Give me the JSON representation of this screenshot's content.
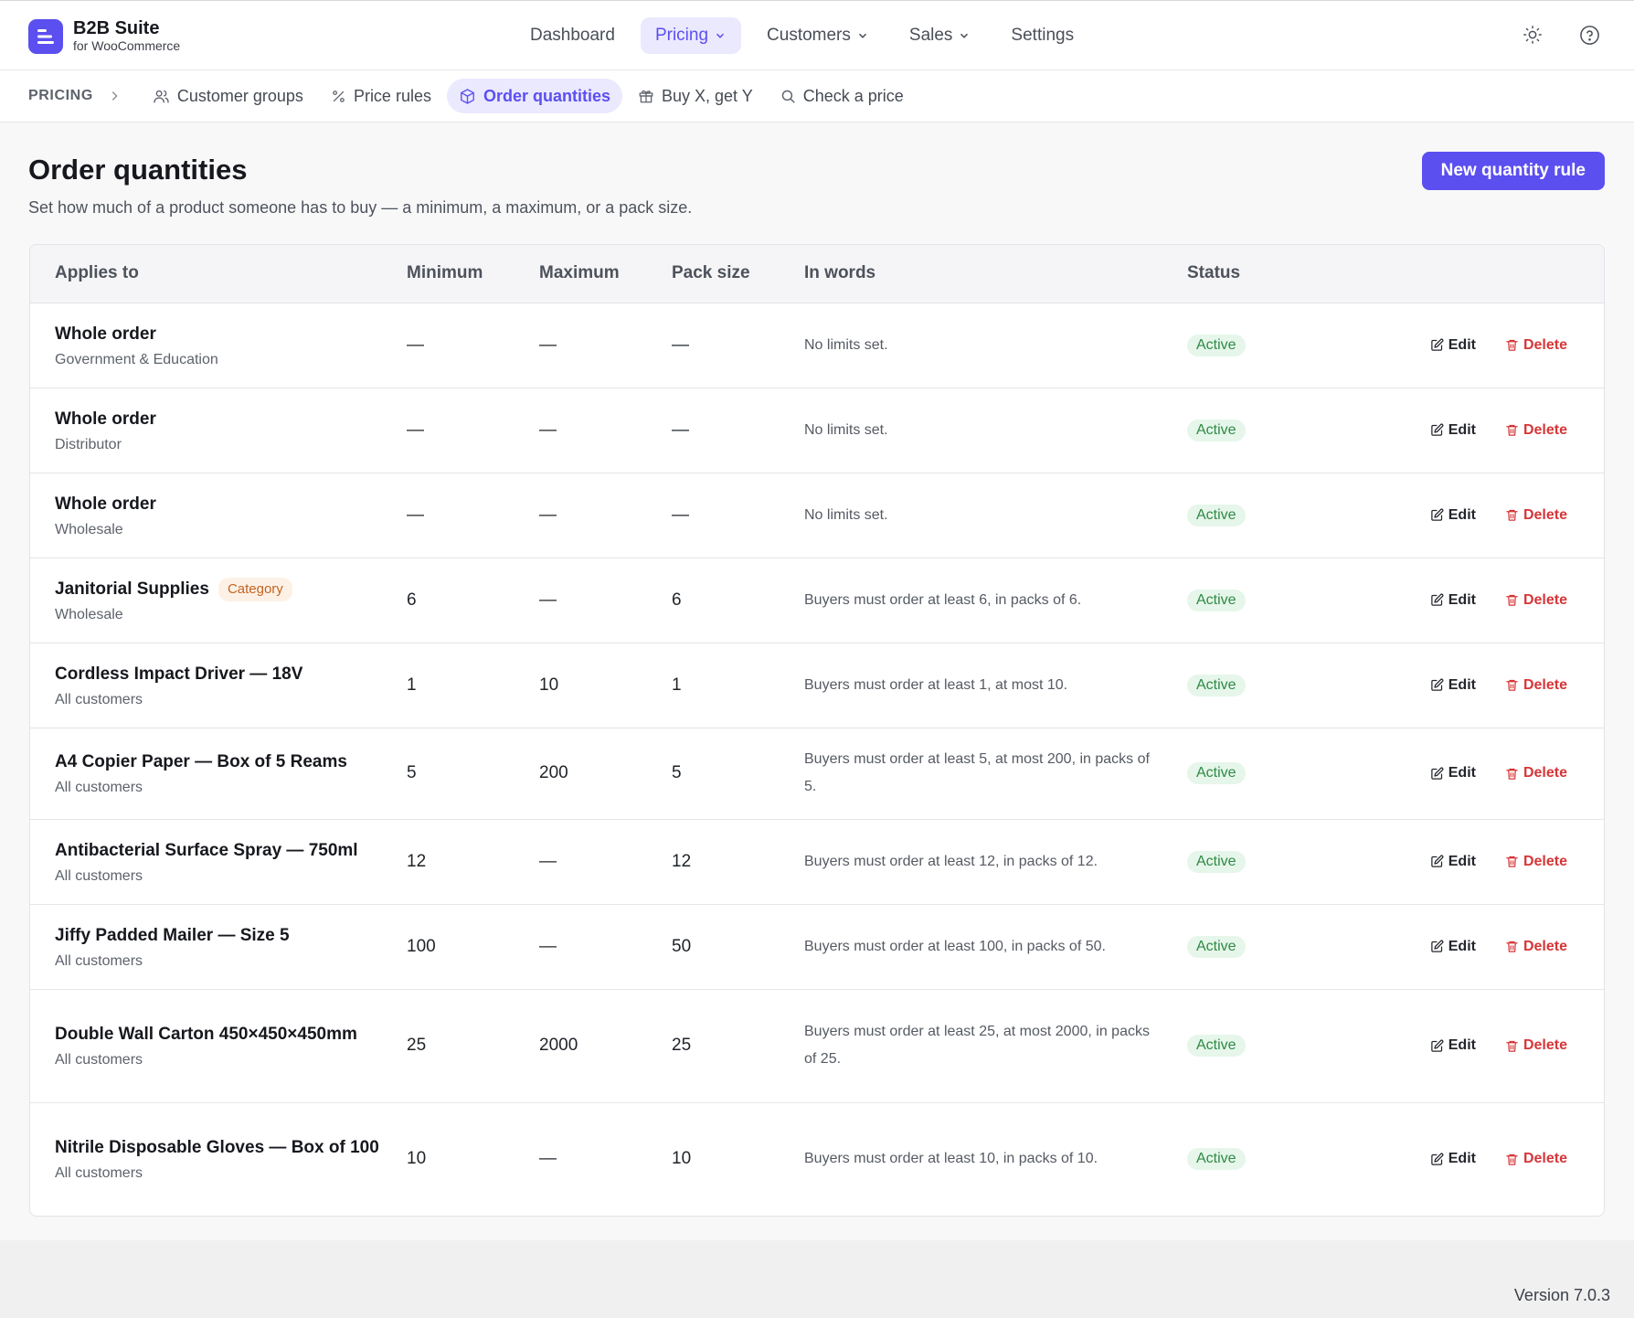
{
  "brand": {
    "name": "B2B Suite",
    "sub": "for WooCommerce",
    "color": "#5b4ff0"
  },
  "nav": [
    {
      "label": "Dashboard",
      "active": false,
      "dropdown": false
    },
    {
      "label": "Pricing",
      "active": true,
      "dropdown": true
    },
    {
      "label": "Customers",
      "active": false,
      "dropdown": true
    },
    {
      "label": "Sales",
      "active": false,
      "dropdown": true
    },
    {
      "label": "Settings",
      "active": false,
      "dropdown": false
    }
  ],
  "top_icons": [
    "sun-icon",
    "help-circle-icon"
  ],
  "subnav": {
    "crumb": "PRICING",
    "items": [
      {
        "label": "Customer groups",
        "icon": "users-icon"
      },
      {
        "label": "Price rules",
        "icon": "percent-icon"
      },
      {
        "label": "Order quantities",
        "icon": "box-icon",
        "active": true
      },
      {
        "label": "Buy X, get Y",
        "icon": "gift-icon"
      },
      {
        "label": "Check a price",
        "icon": "search-icon"
      }
    ]
  },
  "page": {
    "title": "Order quantities",
    "description": "Set how much of a product someone has to buy — a minimum, a maximum, or a pack size.",
    "new_button": "New quantity rule"
  },
  "table": {
    "headers": {
      "applies_to": "Applies to",
      "minimum": "Minimum",
      "maximum": "Maximum",
      "pack_size": "Pack size",
      "in_words": "In words",
      "status": "Status"
    },
    "edit_label": "Edit",
    "delete_label": "Delete",
    "rows": [
      {
        "name": "Whole order",
        "sub": "Government & Education",
        "badge": "",
        "min": "—",
        "max": "—",
        "pack": "—",
        "words": "No limits set.",
        "status": "Active"
      },
      {
        "name": "Whole order",
        "sub": "Distributor",
        "badge": "",
        "min": "—",
        "max": "—",
        "pack": "—",
        "words": "No limits set.",
        "status": "Active"
      },
      {
        "name": "Whole order",
        "sub": "Wholesale",
        "badge": "",
        "min": "—",
        "max": "—",
        "pack": "—",
        "words": "No limits set.",
        "status": "Active"
      },
      {
        "name": "Janitorial Supplies",
        "sub": "Wholesale",
        "badge": "Category",
        "min": "6",
        "max": "—",
        "pack": "6",
        "words": "Buyers must order at least 6, in packs of 6.",
        "status": "Active"
      },
      {
        "name": "Cordless Impact Driver — 18V",
        "sub": "All customers",
        "badge": "",
        "min": "1",
        "max": "10",
        "pack": "1",
        "words": "Buyers must order at least 1, at most 10.",
        "status": "Active"
      },
      {
        "name": "A4 Copier Paper — Box of 5 Reams",
        "sub": "All customers",
        "badge": "",
        "min": "5",
        "max": "200",
        "pack": "5",
        "words": "Buyers must order at least 5, at most 200, in packs of 5.",
        "status": "Active"
      },
      {
        "name": "Antibacterial Surface Spray — 750ml",
        "sub": "All customers",
        "badge": "",
        "min": "12",
        "max": "—",
        "pack": "12",
        "words": "Buyers must order at least 12, in packs of 12.",
        "status": "Active"
      },
      {
        "name": "Jiffy Padded Mailer — Size 5",
        "sub": "All customers",
        "badge": "",
        "min": "100",
        "max": "—",
        "pack": "50",
        "words": "Buyers must order at least 100, in packs of 50.",
        "status": "Active"
      },
      {
        "name": "Double Wall Carton 450×450×450mm",
        "sub": "All customers",
        "badge": "",
        "min": "25",
        "max": "2000",
        "pack": "25",
        "words": "Buyers must order at least 25, at most 2000, in packs of 25.",
        "status": "Active"
      },
      {
        "name": "Nitrile Disposable Gloves — Box of 100",
        "sub": "All customers",
        "badge": "",
        "min": "10",
        "max": "—",
        "pack": "10",
        "words": "Buyers must order at least 10, in packs of 10.",
        "status": "Active"
      }
    ]
  },
  "footer": {
    "version": "Version 7.0.3"
  }
}
